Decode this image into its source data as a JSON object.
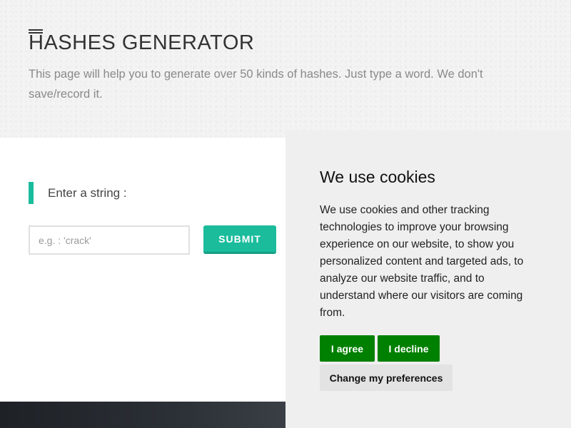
{
  "header": {
    "title": "HASHES GENERATOR",
    "subtitle": "This page will help you to generate over 50 kinds of hashes. Just type a word. We don't save/record it."
  },
  "form": {
    "label": "Enter a string :",
    "input_placeholder": "e.g. : 'crack'",
    "input_value": "",
    "submit_label": "SUBMIT"
  },
  "cookie": {
    "title": "We use cookies",
    "body": "We use cookies and other tracking technologies to improve your browsing experience on our website, to show you personalized content and targeted ads, to analyze our website traffic, and to understand where our visitors are coming from.",
    "agree_label": "I agree",
    "decline_label": "I decline",
    "preferences_label": "Change my preferences"
  },
  "colors": {
    "accent": "#1abc9c",
    "cookie_button": "#008000",
    "cookie_panel_bg": "#efefef"
  }
}
